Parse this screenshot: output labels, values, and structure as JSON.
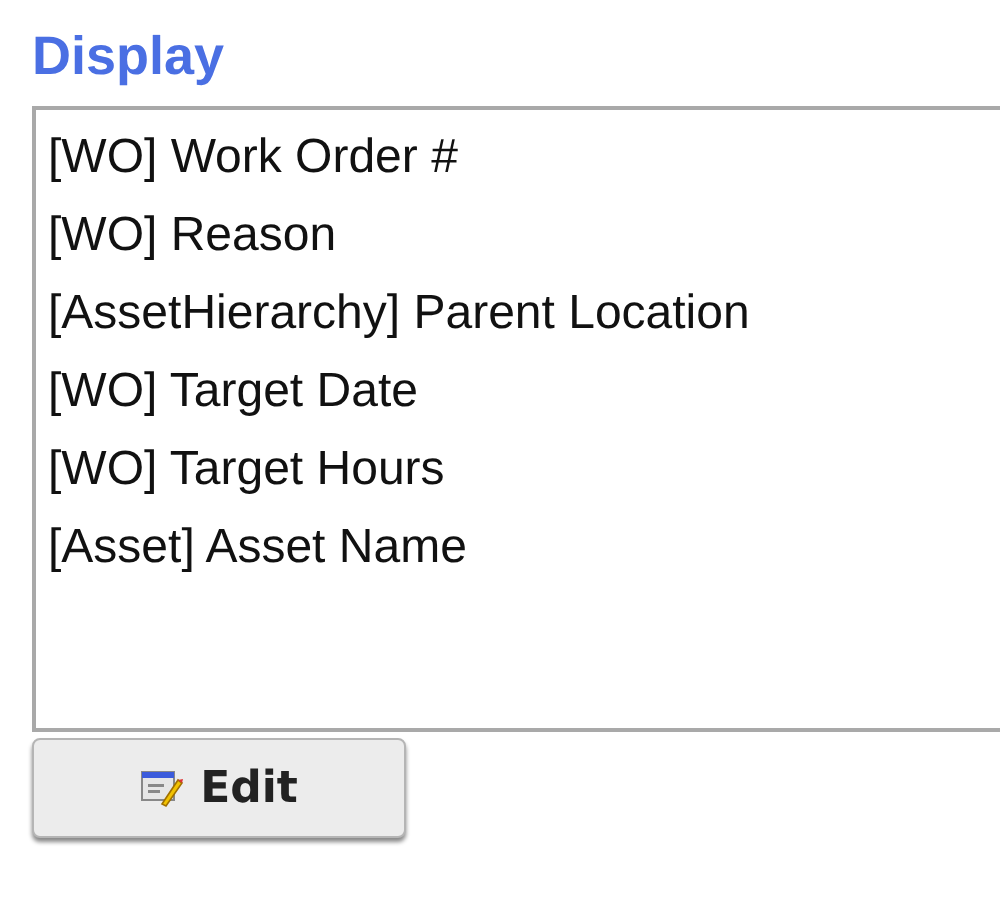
{
  "title": "Display",
  "items": [
    {
      "label": "[WO] Work Order #"
    },
    {
      "label": "[WO] Reason"
    },
    {
      "label": "[AssetHierarchy] Parent Location"
    },
    {
      "label": "[WO] Target Date"
    },
    {
      "label": "[WO] Target Hours"
    },
    {
      "label": "[Asset] Asset Name"
    }
  ],
  "button": {
    "label": "Edit"
  }
}
